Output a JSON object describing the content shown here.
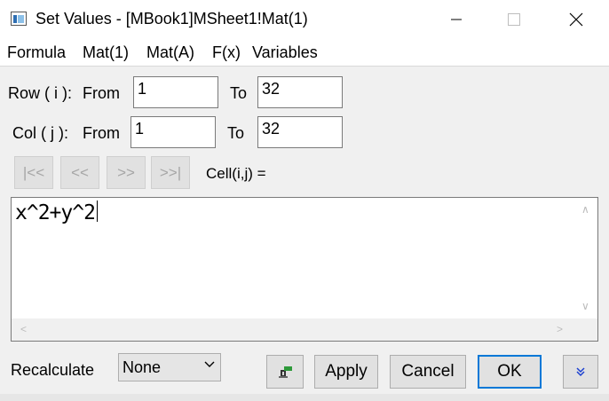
{
  "window": {
    "title": "Set Values - [MBook1]MSheet1!Mat(1)"
  },
  "menu": {
    "items": [
      "Formula",
      "Mat(1)",
      "Mat(A)",
      "F(x)",
      "Variables"
    ]
  },
  "row": {
    "label": "Row ( i ):",
    "from_label": "From",
    "from_value": "1",
    "to_label": "To",
    "to_value": "32"
  },
  "col": {
    "label": "Col  ( j ):",
    "from_label": "From",
    "from_value": "1",
    "to_label": "To",
    "to_value": "32"
  },
  "navigation": {
    "first": "|<<",
    "prev": "<<",
    "next": ">>",
    "last": ">>|",
    "cell_label": "Cell(i,j) ="
  },
  "formula": {
    "text": "x^2+y^2"
  },
  "bottom": {
    "recalculate_label": "Recalculate",
    "recalculate_value": "None",
    "apply_label": "Apply",
    "cancel_label": "Cancel",
    "ok_label": "OK"
  },
  "icons": {
    "app": "matrix-app-icon",
    "minimize": "minimize-icon",
    "maximize": "maximize-icon",
    "close": "close-icon",
    "pin": "pin-icon",
    "expand": "double-chevron-down-icon",
    "dropdown": "chevron-down-icon"
  },
  "colors": {
    "accent": "#0078d7",
    "disabled_text": "#a6a6a6",
    "app_icon_blue": "#2f6fb3"
  }
}
